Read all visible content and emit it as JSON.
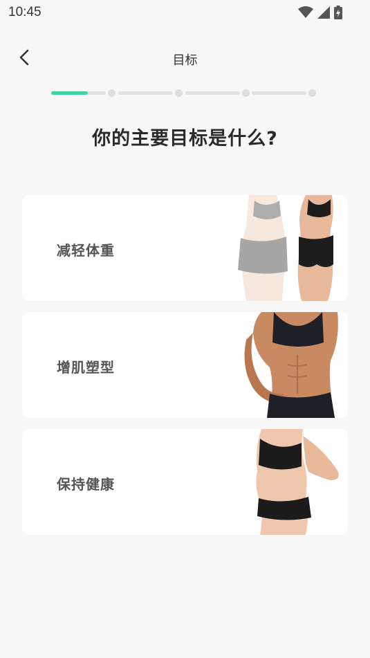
{
  "status_bar": {
    "time": "10:45",
    "icons": [
      "wifi-icon",
      "cellular-signal-icon",
      "battery-charging-icon"
    ]
  },
  "header": {
    "back_icon": "chevron-left-icon",
    "title": "目标"
  },
  "progress": {
    "current_step": 1,
    "total_steps": 4,
    "step_fill_fraction": 0.67,
    "accent_color": "#43d3a0",
    "track_color": "#e2e2e2"
  },
  "question": "你的主要目标是什么?",
  "goals": [
    {
      "label": "减轻体重",
      "image": "before-after-weight-loss-photo"
    },
    {
      "label": "增肌塑型",
      "image": "toned-abs-photo"
    },
    {
      "label": "保持健康",
      "image": "slim-body-photo"
    }
  ]
}
